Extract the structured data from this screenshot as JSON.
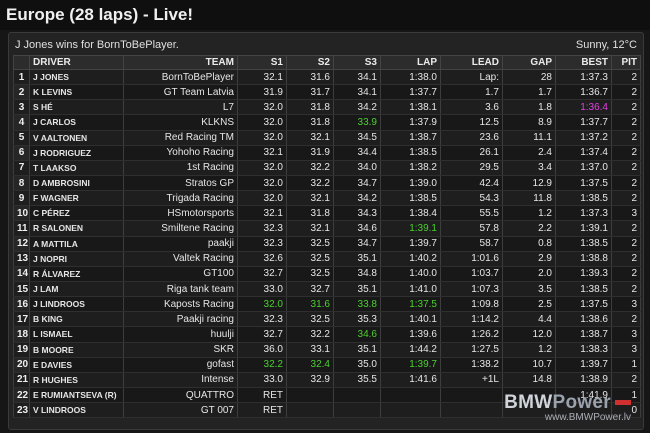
{
  "header": {
    "title": "Europe (28 laps) - Live!"
  },
  "info": {
    "message": "J Jones wins for BornToBePlayer.",
    "weather": "Sunny, 12°C"
  },
  "columns": [
    "",
    "DRIVER",
    "TEAM",
    "S1",
    "S2",
    "S3",
    "LAP",
    "LEAD",
    "GAP",
    "BEST",
    "PIT"
  ],
  "rows": [
    {
      "pos": "1",
      "driver": "J JONES",
      "team": "BornToBePlayer",
      "s1": "32.1",
      "s2": "31.6",
      "s3": "34.1",
      "lap": "1:38.0",
      "lead": "Lap:",
      "gap": "28",
      "best": "1:37.3",
      "pit": "2"
    },
    {
      "pos": "2",
      "driver": "K LEVINS",
      "team": "GT Team Latvia",
      "s1": "31.9",
      "s2": "31.7",
      "s3": "34.1",
      "lap": "1:37.7",
      "lead": "1.7",
      "gap": "1.7",
      "best": "1:36.7",
      "pit": "2"
    },
    {
      "pos": "3",
      "driver": "S HÉ",
      "team": "L7",
      "s1": "32.0",
      "s2": "31.8",
      "s3": "34.2",
      "lap": "1:38.1",
      "lead": "3.6",
      "gap": "1.8",
      "best": "1:36.4",
      "pit": "2"
    },
    {
      "pos": "4",
      "driver": "J CARLOS",
      "team": "KLKNS",
      "s1": "32.0",
      "s2": "31.8",
      "s3": "33.9",
      "lap": "1:37.9",
      "lead": "12.5",
      "gap": "8.9",
      "best": "1:37.7",
      "pit": "2"
    },
    {
      "pos": "5",
      "driver": "V AALTONEN",
      "team": "Red Racing TM",
      "s1": "32.0",
      "s2": "32.1",
      "s3": "34.5",
      "lap": "1:38.7",
      "lead": "23.6",
      "gap": "11.1",
      "best": "1:37.2",
      "pit": "2"
    },
    {
      "pos": "6",
      "driver": "J RODRIGUEZ",
      "team": "Yohoho Racing",
      "s1": "32.1",
      "s2": "31.9",
      "s3": "34.4",
      "lap": "1:38.5",
      "lead": "26.1",
      "gap": "2.4",
      "best": "1:37.4",
      "pit": "2"
    },
    {
      "pos": "7",
      "driver": "T LAAKSO",
      "team": "1st Racing",
      "s1": "32.0",
      "s2": "32.2",
      "s3": "34.0",
      "lap": "1:38.2",
      "lead": "29.5",
      "gap": "3.4",
      "best": "1:37.0",
      "pit": "2"
    },
    {
      "pos": "8",
      "driver": "D AMBROSINI",
      "team": "Stratos GP",
      "s1": "32.0",
      "s2": "32.2",
      "s3": "34.7",
      "lap": "1:39.0",
      "lead": "42.4",
      "gap": "12.9",
      "best": "1:37.5",
      "pit": "2"
    },
    {
      "pos": "9",
      "driver": "F WAGNER",
      "team": "Trigada Racing",
      "s1": "32.0",
      "s2": "32.1",
      "s3": "34.2",
      "lap": "1:38.5",
      "lead": "54.3",
      "gap": "11.8",
      "best": "1:38.5",
      "pit": "2"
    },
    {
      "pos": "10",
      "driver": "C PÉREZ",
      "team": "HSmotorsports",
      "s1": "32.1",
      "s2": "31.8",
      "s3": "34.3",
      "lap": "1:38.4",
      "lead": "55.5",
      "gap": "1.2",
      "best": "1:37.3",
      "pit": "3"
    },
    {
      "pos": "11",
      "driver": "R SALONEN",
      "team": "Smiltene Racing",
      "s1": "32.3",
      "s2": "32.1",
      "s3": "34.6",
      "lap": "1:39.1",
      "lead": "57.8",
      "gap": "2.2",
      "best": "1:39.1",
      "pit": "2"
    },
    {
      "pos": "12",
      "driver": "A MATTILA",
      "team": "paakji",
      "s1": "32.3",
      "s2": "32.5",
      "s3": "34.7",
      "lap": "1:39.7",
      "lead": "58.7",
      "gap": "0.8",
      "best": "1:38.5",
      "pit": "2"
    },
    {
      "pos": "13",
      "driver": "J NOPRI",
      "team": "Valtek Racing",
      "s1": "32.6",
      "s2": "32.5",
      "s3": "35.1",
      "lap": "1:40.2",
      "lead": "1:01.6",
      "gap": "2.9",
      "best": "1:38.8",
      "pit": "2"
    },
    {
      "pos": "14",
      "driver": "R ÁLVAREZ",
      "team": "GT100",
      "s1": "32.7",
      "s2": "32.5",
      "s3": "34.8",
      "lap": "1:40.0",
      "lead": "1:03.7",
      "gap": "2.0",
      "best": "1:39.3",
      "pit": "2"
    },
    {
      "pos": "15",
      "driver": "J LAM",
      "team": "Riga tank team",
      "s1": "33.0",
      "s2": "32.7",
      "s3": "35.1",
      "lap": "1:41.0",
      "lead": "1:07.3",
      "gap": "3.5",
      "best": "1:38.5",
      "pit": "2"
    },
    {
      "pos": "16",
      "driver": "J LINDROOS",
      "team": "Kaposts Racing",
      "s1": "32.0",
      "s2": "31.6",
      "s3": "33.8",
      "lap": "1:37.5",
      "lead": "1:09.8",
      "gap": "2.5",
      "best": "1:37.5",
      "pit": "3"
    },
    {
      "pos": "17",
      "driver": "B KING",
      "team": "Paakji racing",
      "s1": "32.3",
      "s2": "32.5",
      "s3": "35.3",
      "lap": "1:40.1",
      "lead": "1:14.2",
      "gap": "4.4",
      "best": "1:38.6",
      "pit": "2"
    },
    {
      "pos": "18",
      "driver": "L ISMAEL",
      "team": "huulji",
      "s1": "32.7",
      "s2": "32.2",
      "s3": "34.6",
      "lap": "1:39.6",
      "lead": "1:26.2",
      "gap": "12.0",
      "best": "1:38.7",
      "pit": "3"
    },
    {
      "pos": "19",
      "driver": "B MOORE",
      "team": "SKR",
      "s1": "36.0",
      "s2": "33.1",
      "s3": "35.1",
      "lap": "1:44.2",
      "lead": "1:27.5",
      "gap": "1.2",
      "best": "1:38.3",
      "pit": "3"
    },
    {
      "pos": "20",
      "driver": "E DAVIES",
      "team": "gofast",
      "s1": "32.2",
      "s2": "32.4",
      "s3": "35.0",
      "lap": "1:39.7",
      "lead": "1:38.2",
      "gap": "10.7",
      "best": "1:39.7",
      "pit": "1"
    },
    {
      "pos": "21",
      "driver": "R HUGHES",
      "team": "Intense",
      "s1": "33.0",
      "s2": "32.9",
      "s3": "35.5",
      "lap": "1:41.6",
      "lead": "+1L",
      "gap": "14.8",
      "best": "1:38.9",
      "pit": "2"
    },
    {
      "pos": "22",
      "driver": "E RUMIANTSEVA (R)",
      "team": "QUATTRO",
      "s1": "RET",
      "s2": "",
      "s3": "",
      "lap": "",
      "lead": "",
      "gap": "",
      "best": "1:41.9",
      "pit": "1"
    },
    {
      "pos": "23",
      "driver": "V LINDROOS",
      "team": "GT 007",
      "s1": "RET",
      "s2": "",
      "s3": "",
      "lap": "",
      "lead": "",
      "gap": "",
      "best": "",
      "pit": "0"
    }
  ],
  "highlights": {
    "green": [
      "3.s3",
      "15.s1",
      "15.s2",
      "15.s3",
      "15.lap",
      "19.s1",
      "19.s2",
      "19.lap",
      "10.lap",
      "17.s3"
    ],
    "purple": [
      "2.best"
    ]
  },
  "colors": {
    "green": "#4ccf2f",
    "purple": "#e040e0",
    "background": "#161616"
  },
  "logo": {
    "name_bold": "BMW",
    "name_rest": "Power",
    "url": "www.BMWPower.lv"
  }
}
